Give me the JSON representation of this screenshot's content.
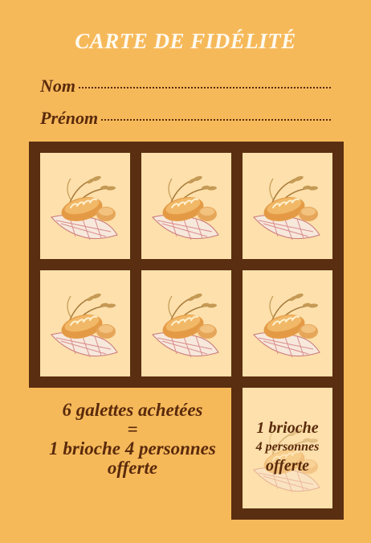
{
  "card": {
    "title": "CARTE DE FIDÉLITÉ",
    "fields": {
      "nom_label": "Nom",
      "prenom_label": "Prénom"
    }
  },
  "stamps": {
    "count": 6,
    "icon": "bread-loaf-icon"
  },
  "offer": {
    "line1": "6 galettes achetées",
    "line2": "=",
    "line3": "1 brioche 4 personnes",
    "line4": "offerte"
  },
  "gift_cell": {
    "line1": "1 brioche",
    "line2": "4 personnes",
    "line3": "offerte"
  },
  "colors": {
    "background": "#f6b95a",
    "frame": "#5a2e10",
    "cell": "#fde0ab",
    "text": "#5a2a0c"
  }
}
